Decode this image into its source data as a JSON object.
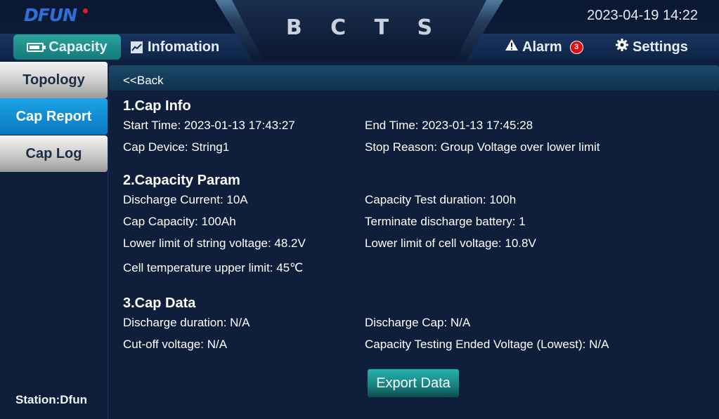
{
  "header": {
    "logo": "DFUN",
    "title": "B C T S",
    "datetime": "2023-04-19 14:22",
    "tabs": {
      "capacity": "Capacity",
      "information": "Infomation",
      "alarm": "Alarm",
      "alarm_count": "3",
      "settings": "Settings"
    }
  },
  "sidebar": {
    "items": [
      "Topology",
      "Cap Report",
      "Cap Log"
    ],
    "active": "Cap Report",
    "station": "Station:Dfun"
  },
  "main": {
    "back": "<<Back",
    "cap_info": {
      "title": "1.Cap Info",
      "start_time": "Start Time: 2023-01-13 17:43:27",
      "end_time": "End Time: 2023-01-13 17:45:28",
      "cap_device": "Cap Device: String1",
      "stop_reason": "Stop Reason: Group Voltage over lower limit"
    },
    "capacity_param": {
      "title": "2.Capacity Param",
      "discharge_current": "Discharge Current: 10A",
      "test_duration": "Capacity Test duration: 100h",
      "cap_capacity": "Cap Capacity: 100Ah",
      "terminate_battery": "Terminate discharge battery: 1",
      "lower_string_voltage": "Lower limit of string voltage: 48.2V",
      "lower_cell_voltage": "Lower limit of cell voltage: 10.8V",
      "cell_temp_limit": "Cell temperature upper limit: 45℃"
    },
    "cap_data": {
      "title": "3.Cap Data",
      "discharge_duration": "Discharge duration: N/A",
      "discharge_cap": "Discharge Cap: N/A",
      "cutoff_voltage": "Cut-off voltage: N/A",
      "ended_voltage": "Capacity Testing Ended Voltage (Lowest): N/A"
    },
    "export_label": "Export Data"
  },
  "colors": {
    "background": "#0f1e3a",
    "accent_teal": "#1f8f8b",
    "active_blue": "#0b8ad6",
    "alarm_red": "#e01010",
    "logo_blue": "#2f6fd8"
  },
  "icons": {
    "capacity": "battery-icon",
    "information": "chart-icon",
    "alarm": "warning-icon",
    "settings": "gear-icon"
  }
}
